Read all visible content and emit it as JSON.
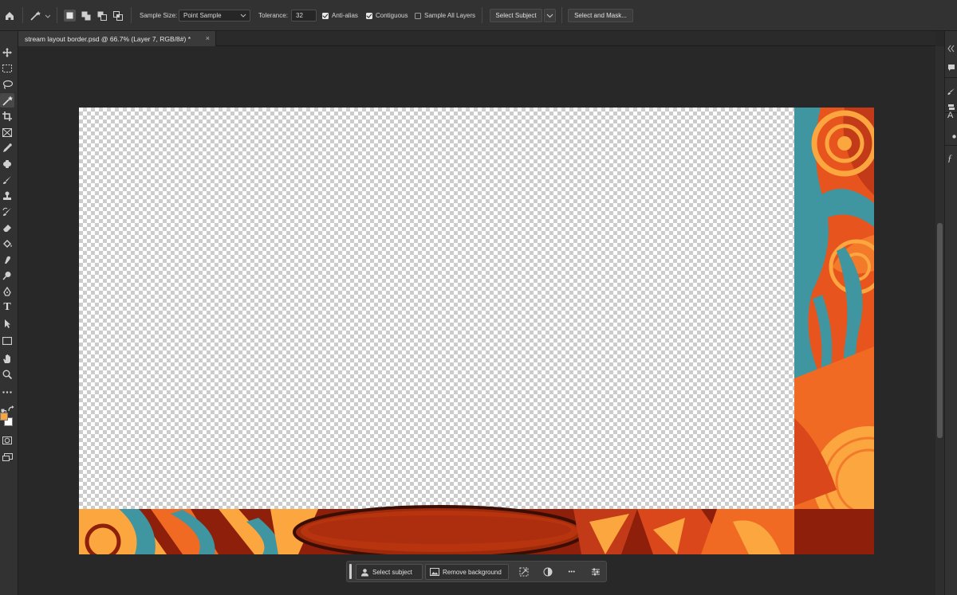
{
  "options_bar": {
    "sample_size_label": "Sample Size:",
    "sample_size_value": "Point Sample",
    "tolerance_label": "Tolerance:",
    "tolerance_value": "32",
    "anti_alias_label": "Anti-alias",
    "anti_alias_checked": true,
    "contiguous_label": "Contiguous",
    "contiguous_checked": true,
    "sample_all_layers_label": "Sample All Layers",
    "sample_all_layers_checked": false,
    "select_subject_label": "Select Subject",
    "select_and_mask_label": "Select and Mask..."
  },
  "document": {
    "tab_title": "stream layout border.psd @ 66.7% (Layer 7, RGB/8#) *",
    "close_glyph": "×"
  },
  "tools": [
    "move-icon",
    "marquee-icon",
    "lasso-icon",
    "magic-wand-icon",
    "crop-icon",
    "frame-icon",
    "eyedropper-icon",
    "healing-brush-icon",
    "brush-icon",
    "clone-stamp-icon",
    "history-brush-icon",
    "eraser-icon",
    "paint-bucket-icon",
    "smudge-icon",
    "dodge-icon",
    "pen-icon",
    "type-icon",
    "path-selection-icon",
    "rectangle-icon",
    "hand-icon",
    "zoom-icon",
    "more-tools-icon"
  ],
  "type_tool_glyph": "T",
  "colors": {
    "foreground": "#f9a43d",
    "background": "#ffffff",
    "artwork_teal": "#3f95a0",
    "artwork_orange": "#e8541e",
    "artwork_yellow": "#fba63f",
    "artwork_red": "#8e1f0b"
  },
  "contextual_task_bar": {
    "select_subject_label": "Select subject",
    "remove_background_label": "Remove background",
    "more_glyph": "•••"
  },
  "right_panel": {
    "glyphs": [
      "A",
      "ƒ"
    ]
  }
}
